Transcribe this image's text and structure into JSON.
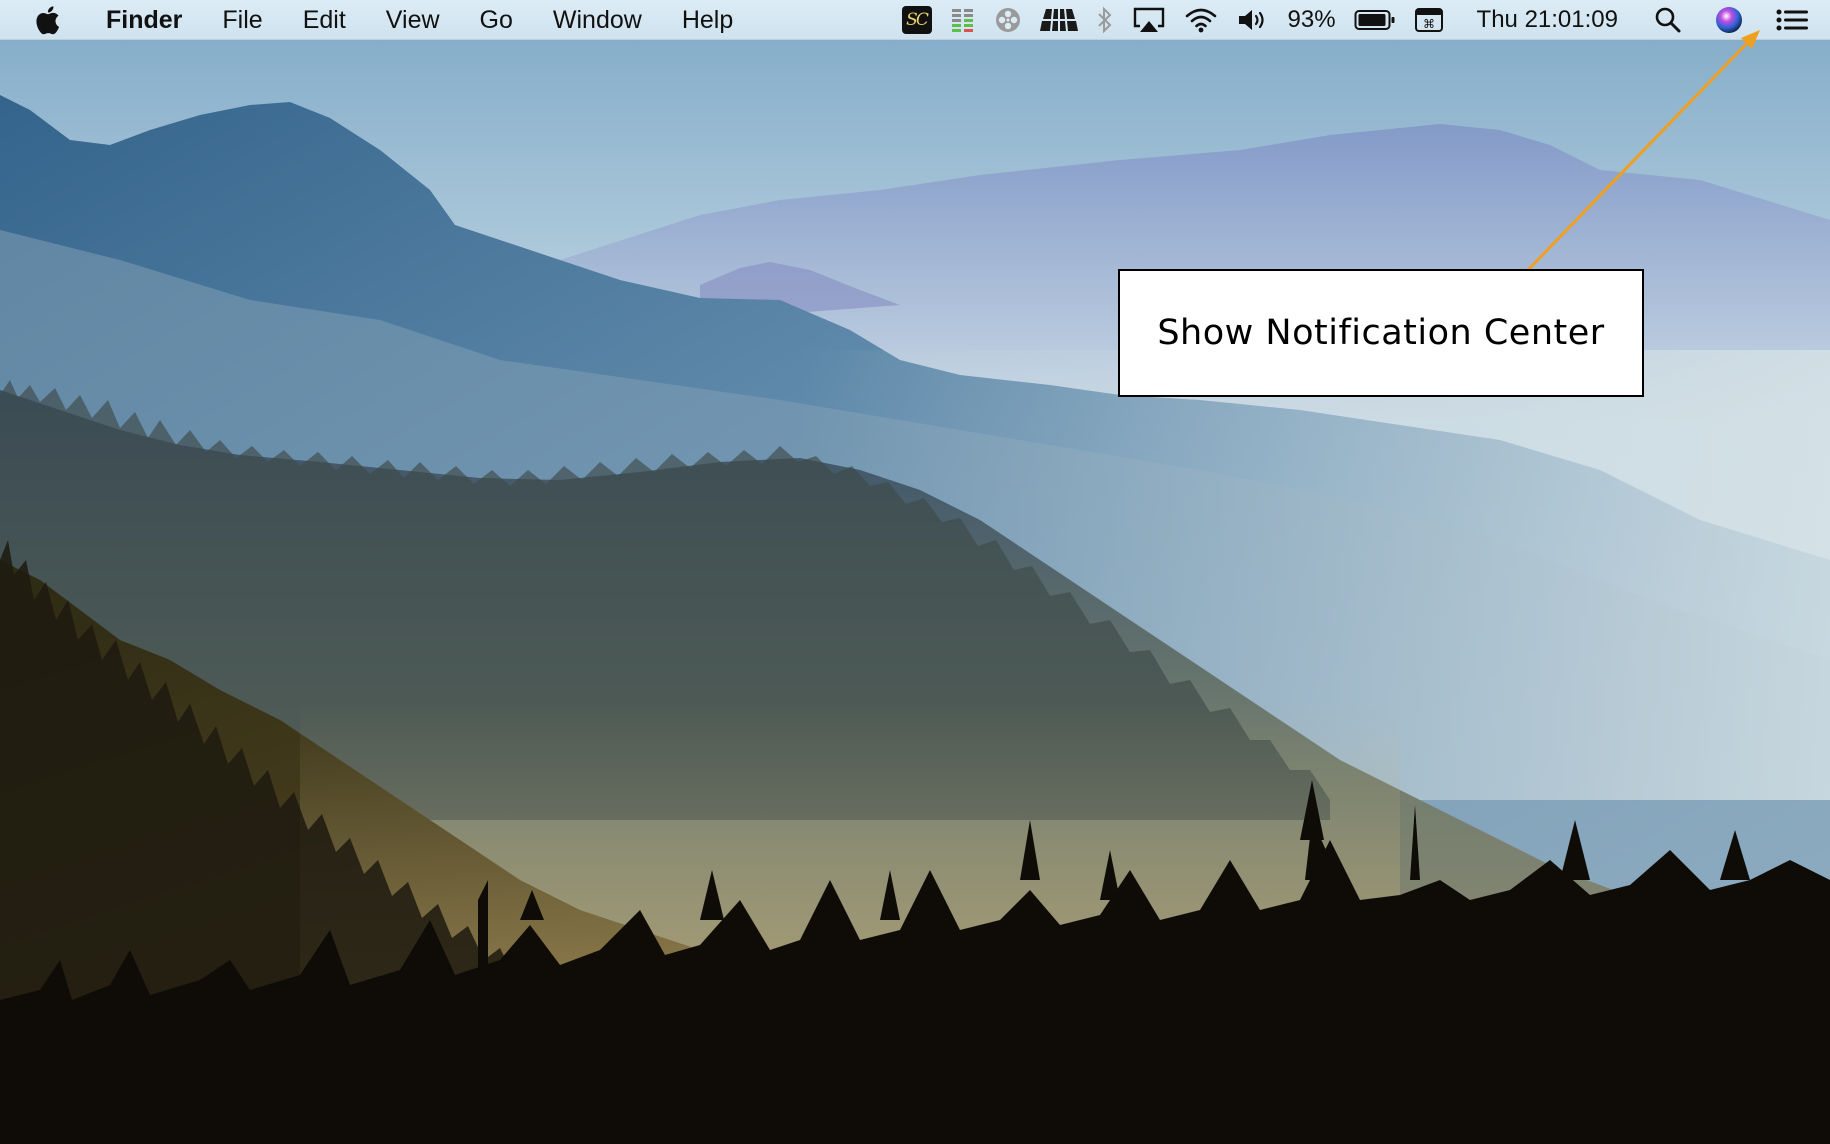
{
  "menubar": {
    "apple_icon": "apple-logo-icon",
    "app_name": "Finder",
    "menus": [
      "File",
      "Edit",
      "View",
      "Go",
      "Window",
      "Help"
    ],
    "status_items": {
      "sc_label": "SC",
      "battery_percent": "93%",
      "clock": "Thu 21:01:09"
    },
    "icons": [
      "sc-app-icon",
      "activity-meter-icon",
      "film-reel-icon",
      "dock-icon",
      "bluetooth-icon",
      "airplay-icon",
      "wifi-icon",
      "volume-icon",
      "battery-icon",
      "keyboard-icon",
      "spotlight-search-icon",
      "siri-icon",
      "notification-center-icon"
    ]
  },
  "callout": {
    "text": "Show Notification Center",
    "arrow_color": "#f0a020"
  }
}
